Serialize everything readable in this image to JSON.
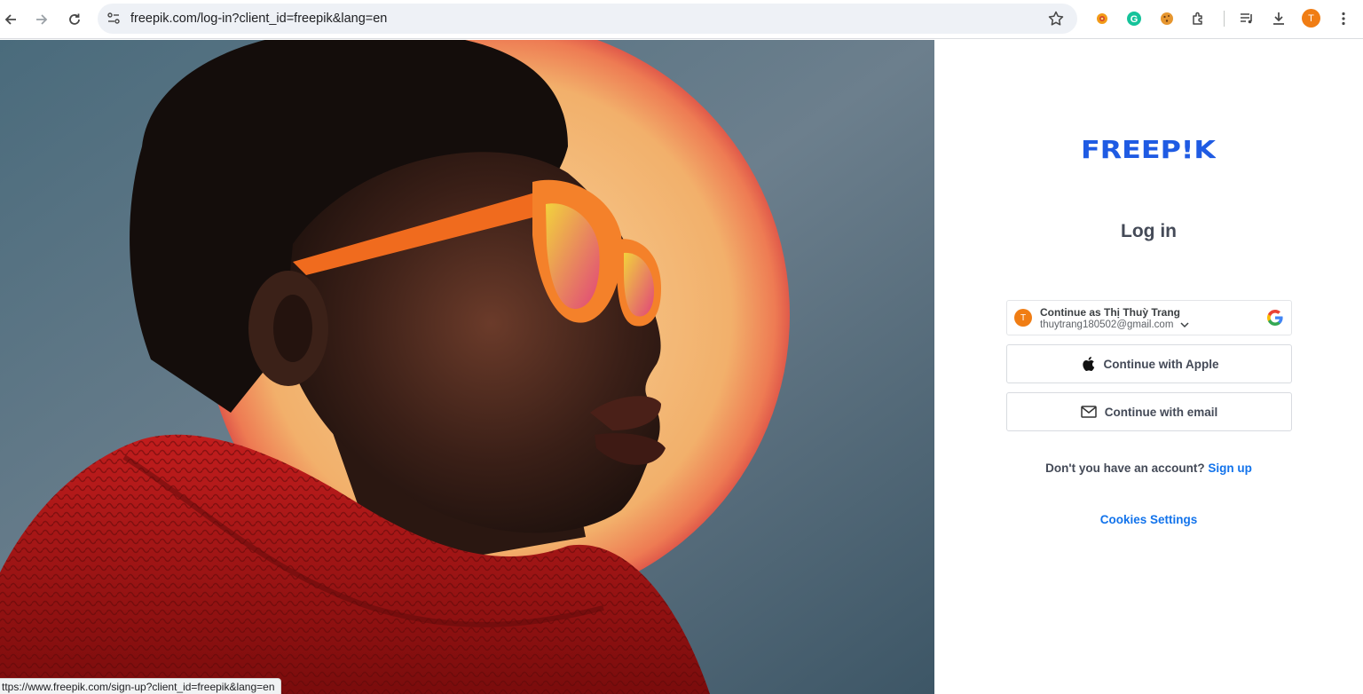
{
  "browser": {
    "url": "freepik.com/log-in?client_id=freepik&lang=en",
    "profile_initial": "T",
    "status_url": "ttps://www.freepik.com/sign-up?client_id=freepik&lang=en"
  },
  "panel": {
    "logo_text": "FREEP!K",
    "title": "Log in",
    "google": {
      "avatar_initial": "T",
      "continue_as": "Continue as Thị Thuỳ Trang",
      "email": "thuytrang180502@gmail.com"
    },
    "apple_label": "Continue with Apple",
    "email_label": "Continue with email",
    "signup_prompt": "Don't you have an account?",
    "signup_link": "Sign up",
    "cookies_link": "Cookies Settings"
  },
  "colors": {
    "brand_blue": "#1273eb",
    "logo_blue": "#1f5be3",
    "avatar_orange": "#f07d14",
    "text_dark": "#444a57"
  }
}
